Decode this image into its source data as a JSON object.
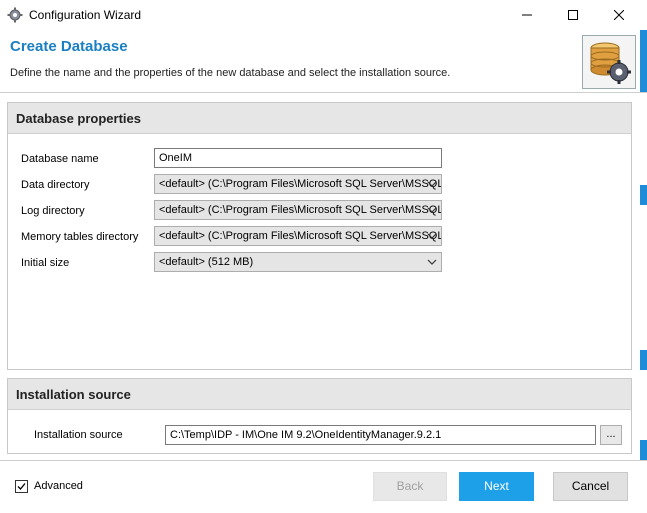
{
  "window": {
    "title": "Configuration Wizard",
    "minimize": "minimize",
    "maximize": "maximize",
    "close": "close"
  },
  "header": {
    "title": "Create Database",
    "subtitle": "Define the name and the properties of the new database and select the installation source."
  },
  "database_properties": {
    "heading": "Database properties",
    "fields": [
      {
        "label": "Database name",
        "value": "OneIM",
        "type": "text"
      },
      {
        "label": "Data directory",
        "value": "<default> (C:\\Program Files\\Microsoft SQL Server\\MSSQL",
        "type": "combo"
      },
      {
        "label": "Log directory",
        "value": "<default> (C:\\Program Files\\Microsoft SQL Server\\MSSQL",
        "type": "combo"
      },
      {
        "label": "Memory tables directory",
        "value": "<default> (C:\\Program Files\\Microsoft SQL Server\\MSSQL",
        "type": "combo"
      },
      {
        "label": "Initial size",
        "value": "<default> (512 MB)",
        "type": "combo"
      }
    ]
  },
  "installation_source": {
    "heading": "Installation source",
    "label": "Installation source",
    "value": "C:\\Temp\\IDP - IM\\One IM 9.2\\OneIdentityManager.9.2.1",
    "browse_label": "..."
  },
  "footer": {
    "advanced_label": "Advanced",
    "advanced_checked": true,
    "back_label": "Back",
    "next_label": "Next",
    "cancel_label": "Cancel"
  },
  "colors": {
    "accent": "#1a7fc3",
    "next_button": "#1ea0e8",
    "panel_header": "#e6e6e6"
  }
}
